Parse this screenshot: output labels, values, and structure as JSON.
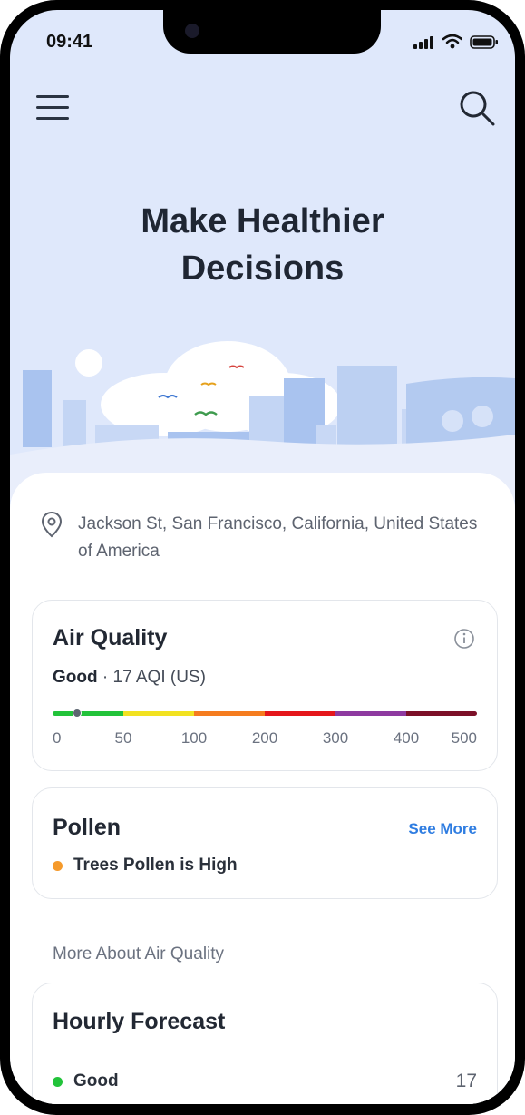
{
  "status_bar": {
    "time": "09:41"
  },
  "header": {
    "menu_icon": "hamburger-menu-icon",
    "search_icon": "search-icon"
  },
  "hero": {
    "title_line1": "Make Healthier",
    "title_line2": "Decisions"
  },
  "location": {
    "icon": "location-pin-icon",
    "text": "Jackson St, San Francisco, California, United States of America"
  },
  "air_quality": {
    "title": "Air Quality",
    "status": "Good",
    "separator": "·",
    "aqi": "17 AQI (US)",
    "value": 17,
    "scale_max": 500,
    "ticks": [
      "0",
      "50",
      "100",
      "200",
      "300",
      "400",
      "500"
    ],
    "colors": [
      "#22c33a",
      "#f2e221",
      "#f57c1f",
      "#e5161b",
      "#8e3aa0",
      "#7c1028"
    ]
  },
  "pollen": {
    "title": "Pollen",
    "see_more": "See More",
    "item": "Trees Pollen is High",
    "item_color": "#f59a2b"
  },
  "more_section": {
    "label": "More About Air Quality"
  },
  "hourly": {
    "title": "Hourly Forecast",
    "status": "Good",
    "value": "17",
    "status_color": "#22c33a"
  }
}
